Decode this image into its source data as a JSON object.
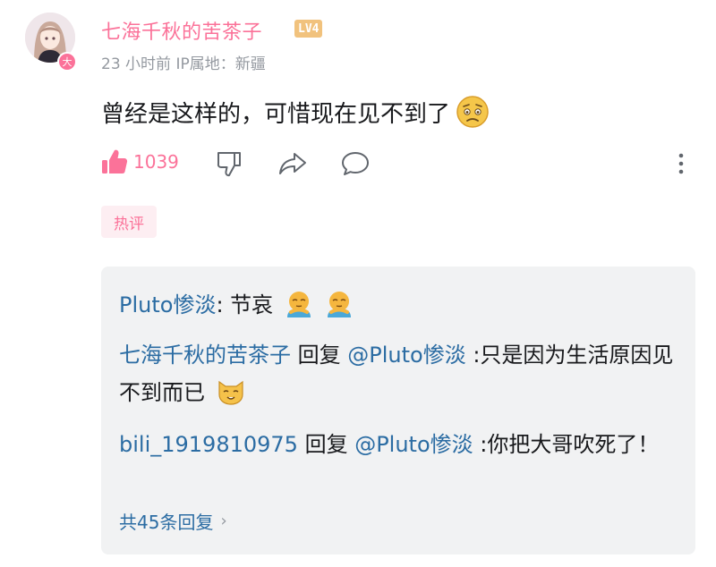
{
  "comment": {
    "username": "七海千秋的苦茶子",
    "level_badge": "LV4",
    "avatar_badge": "大",
    "time": "23 小时前",
    "ip_label": "IP属地：新疆",
    "text": "曾经是这样的，可惜现在见不到了",
    "like_count": "1039",
    "hot_tag": "热评"
  },
  "replies": {
    "items": [
      {
        "user": "Pluto惨淡",
        "sep": ": ",
        "text": "节哀"
      },
      {
        "user": "七海千秋的苦茶子",
        "action": " 回复 ",
        "mention": "@Pluto惨淡",
        "text": " :只是因为生活原因见不到而已"
      },
      {
        "user": "bili_1919810975",
        "action": " 回复 ",
        "mention": "@Pluto惨淡",
        "text": " :你把大哥吹死了！"
      }
    ],
    "more_label": "共45条回复",
    "more_chevron": "›"
  },
  "colors": {
    "accent_pink": "#fb7299",
    "link_blue": "#2b6ca3",
    "meta_gray": "#9499a0",
    "panel_bg": "#f1f2f3"
  }
}
